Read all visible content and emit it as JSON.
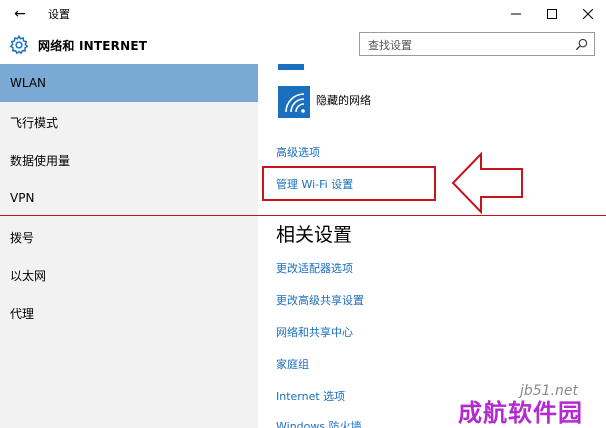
{
  "titlebar": {
    "back_icon": "←",
    "title": "设置",
    "minimize_icon": "—",
    "maximize_icon": "☐",
    "close_icon": "✕"
  },
  "header": {
    "icon": "gear-icon",
    "title": "网络和 INTERNET"
  },
  "search": {
    "placeholder": "查找设置",
    "icon": "search-icon"
  },
  "sidebar": {
    "active_color": "#7aa9d6",
    "items": [
      {
        "label": "WLAN",
        "active": true
      },
      {
        "label": "飞行模式",
        "active": false
      },
      {
        "label": "数据使用量",
        "active": false
      },
      {
        "label": "VPN",
        "active": false
      },
      {
        "label": "拨号",
        "active": false
      },
      {
        "label": "以太网",
        "active": false
      },
      {
        "label": "代理",
        "active": false
      }
    ]
  },
  "main": {
    "network_name": "隐藏的网络",
    "links": {
      "advanced": "高级选项",
      "manage_wifi": "管理 Wi-Fi 设置"
    },
    "related_title": "相关设置",
    "related": [
      "更改适配器选项",
      "更改高级共享设置",
      "网络和共享中心",
      "家庭组",
      "Internet 选项",
      "Windows 防火墙"
    ]
  },
  "accent_color": "#1a6fbf",
  "annotation_color": "#c8141e",
  "watermark": {
    "site": "jb51.net",
    "logo": "成航软件园"
  }
}
